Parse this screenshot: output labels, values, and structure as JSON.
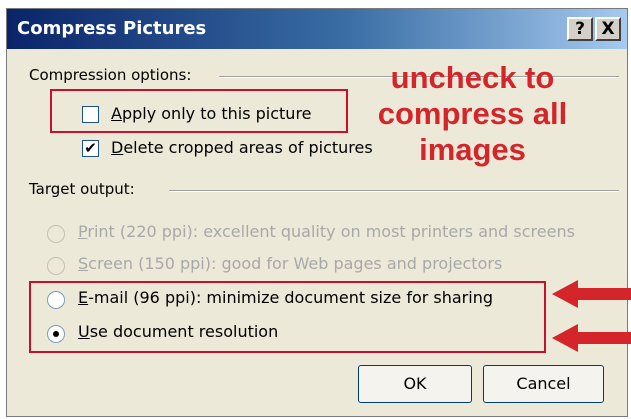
{
  "dialog": {
    "title": "Compress Pictures",
    "help_glyph": "?",
    "close_glyph": "X"
  },
  "compression": {
    "group_label": "Compression options:",
    "apply_only": {
      "label_acc": "A",
      "label_rest": "pply only to this picture",
      "checked": false
    },
    "delete_cropped": {
      "label_acc": "D",
      "label_rest": "elete cropped areas of pictures",
      "checked": true,
      "check_glyph": "✔"
    }
  },
  "target": {
    "group_label": "Target output:",
    "options": [
      {
        "label_acc": "P",
        "label_rest": "rint (220 ppi): excellent quality on most printers and screens",
        "enabled": false,
        "selected": false
      },
      {
        "label_acc": "S",
        "label_rest": "creen (150 ppi): good for Web pages and projectors",
        "enabled": false,
        "selected": false
      },
      {
        "label_acc": "E",
        "label_rest": "-mail (96 ppi): minimize document size for sharing",
        "enabled": true,
        "selected": false
      },
      {
        "label_acc": "U",
        "label_rest": "se document resolution",
        "enabled": true,
        "selected": true
      }
    ]
  },
  "buttons": {
    "ok": "OK",
    "cancel": "Cancel"
  },
  "annotation": {
    "lines": [
      "uncheck to",
      "compress all",
      "images"
    ],
    "color": "#d4252a"
  }
}
